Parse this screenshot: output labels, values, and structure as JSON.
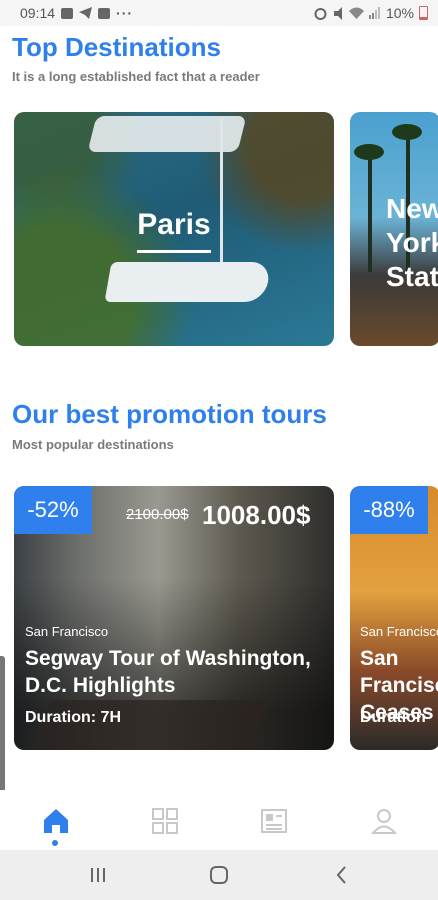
{
  "status_bar": {
    "time": "09:14",
    "battery": "10%",
    "left_icons": [
      "image-icon",
      "telegram-icon",
      "ai-icon"
    ],
    "more": "···",
    "right_icons": [
      "alarm-icon",
      "mute-icon",
      "wifi-icon",
      "signal-icon",
      "battery-icon"
    ]
  },
  "top_destinations": {
    "title": "Top Destinations",
    "subtitle": "It is a long established fact that a reader",
    "cards": [
      {
        "name": "Paris"
      },
      {
        "name": "New York State"
      }
    ]
  },
  "promotion": {
    "title": "Our best promotion tours",
    "subtitle": "Most popular destinations",
    "tours": [
      {
        "discount": "-52%",
        "old_price": "2100.00$",
        "new_price": "1008.00$",
        "city": "San Francisco",
        "name": "Segway Tour of Washington, D.C. Highlights",
        "duration": "Duration: 7H"
      },
      {
        "discount": "-88%",
        "city": "San Francisco",
        "name": "San Francisco Ceases",
        "duration": "Duration"
      }
    ]
  },
  "bottom_nav": {
    "items": [
      "home",
      "grid",
      "news",
      "profile"
    ],
    "active": "home"
  },
  "colors": {
    "accent": "#2f80ed",
    "subtitle": "#7a7a7a"
  }
}
